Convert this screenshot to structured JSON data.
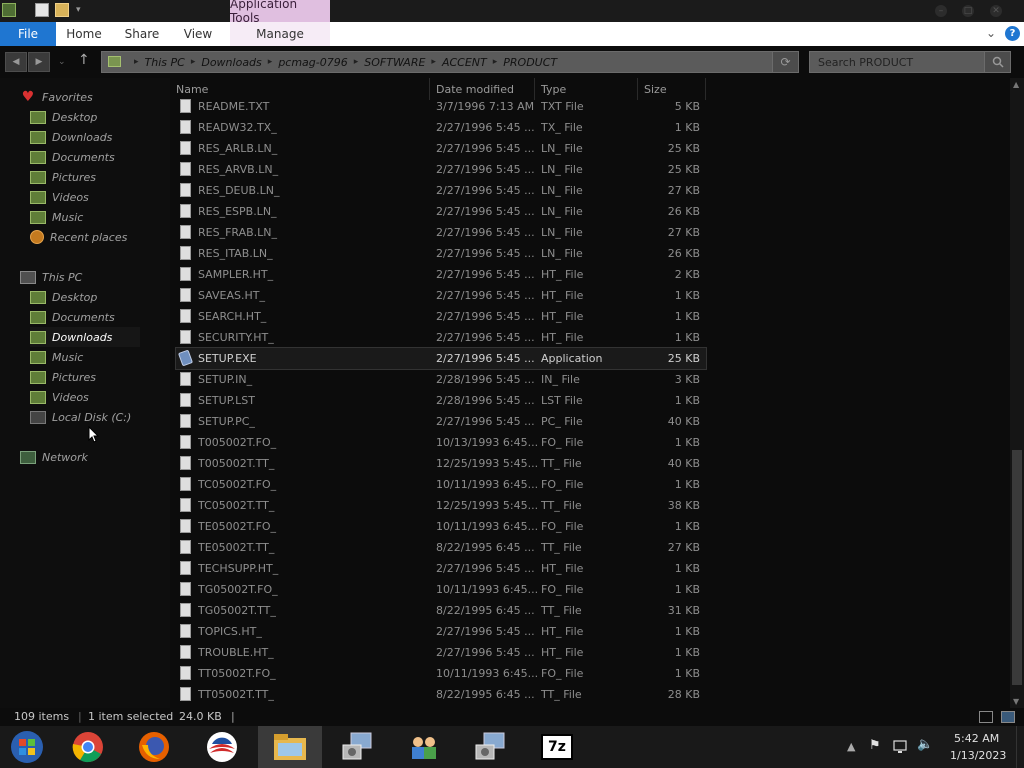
{
  "ribbon": {
    "contextual_group": "Application Tools",
    "file_tab": "File",
    "tabs": [
      "Home",
      "Share",
      "View",
      "Manage"
    ]
  },
  "address": {
    "crumbs": [
      "This PC",
      "Downloads",
      "pcmag-0796",
      "SOFTWARE",
      "ACCENT",
      "PRODUCT"
    ],
    "search_placeholder": "Search PRODUCT"
  },
  "nav": {
    "favorites_label": "Favorites",
    "favorites": [
      {
        "label": "Desktop",
        "icon": "desktop-folder-icon"
      },
      {
        "label": "Downloads",
        "icon": "downloads-folder-icon"
      },
      {
        "label": "Documents",
        "icon": "documents-folder-icon"
      },
      {
        "label": "Pictures",
        "icon": "pictures-folder-icon"
      },
      {
        "label": "Videos",
        "icon": "videos-folder-icon"
      },
      {
        "label": "Music",
        "icon": "music-folder-icon"
      },
      {
        "label": "Recent places",
        "icon": "recent-places-icon"
      }
    ],
    "this_pc_label": "This PC",
    "this_pc": [
      {
        "label": "Desktop",
        "icon": "desktop-folder-icon"
      },
      {
        "label": "Documents",
        "icon": "documents-folder-icon"
      },
      {
        "label": "Downloads",
        "icon": "downloads-folder-icon"
      },
      {
        "label": "Music",
        "icon": "music-folder-icon"
      },
      {
        "label": "Pictures",
        "icon": "pictures-folder-icon"
      },
      {
        "label": "Videos",
        "icon": "videos-folder-icon"
      },
      {
        "label": "Local Disk (C:)",
        "icon": "local-disk-icon"
      }
    ],
    "selected": "Downloads",
    "network_label": "Network"
  },
  "columns": [
    "Name",
    "Date modified",
    "Type",
    "Size"
  ],
  "files": [
    {
      "name": "README.TXT",
      "date": "3/7/1996 7:13 AM",
      "type": "TXT File",
      "size": "5 KB"
    },
    {
      "name": "READW32.TX_",
      "date": "2/27/1996 5:45 ...",
      "type": "TX_ File",
      "size": "1 KB"
    },
    {
      "name": "RES_ARLB.LN_",
      "date": "2/27/1996 5:45 ...",
      "type": "LN_ File",
      "size": "25 KB"
    },
    {
      "name": "RES_ARVB.LN_",
      "date": "2/27/1996 5:45 ...",
      "type": "LN_ File",
      "size": "25 KB"
    },
    {
      "name": "RES_DEUB.LN_",
      "date": "2/27/1996 5:45 ...",
      "type": "LN_ File",
      "size": "27 KB"
    },
    {
      "name": "RES_ESPB.LN_",
      "date": "2/27/1996 5:45 ...",
      "type": "LN_ File",
      "size": "26 KB"
    },
    {
      "name": "RES_FRAB.LN_",
      "date": "2/27/1996 5:45 ...",
      "type": "LN_ File",
      "size": "27 KB"
    },
    {
      "name": "RES_ITAB.LN_",
      "date": "2/27/1996 5:45 ...",
      "type": "LN_ File",
      "size": "26 KB"
    },
    {
      "name": "SAMPLER.HT_",
      "date": "2/27/1996 5:45 ...",
      "type": "HT_ File",
      "size": "2 KB"
    },
    {
      "name": "SAVEAS.HT_",
      "date": "2/27/1996 5:45 ...",
      "type": "HT_ File",
      "size": "1 KB"
    },
    {
      "name": "SEARCH.HT_",
      "date": "2/27/1996 5:45 ...",
      "type": "HT_ File",
      "size": "1 KB"
    },
    {
      "name": "SECURITY.HT_",
      "date": "2/27/1996 5:45 ...",
      "type": "HT_ File",
      "size": "1 KB"
    },
    {
      "name": "SETUP.EXE",
      "date": "2/27/1996 5:45 ...",
      "type": "Application",
      "size": "25 KB",
      "selected": true
    },
    {
      "name": "SETUP.IN_",
      "date": "2/28/1996 5:45 ...",
      "type": "IN_ File",
      "size": "3 KB"
    },
    {
      "name": "SETUP.LST",
      "date": "2/28/1996 5:45 ...",
      "type": "LST File",
      "size": "1 KB"
    },
    {
      "name": "SETUP.PC_",
      "date": "2/27/1996 5:45 ...",
      "type": "PC_ File",
      "size": "40 KB"
    },
    {
      "name": "T005002T.FO_",
      "date": "10/13/1993 6:45...",
      "type": "FO_ File",
      "size": "1 KB"
    },
    {
      "name": "T005002T.TT_",
      "date": "12/25/1993 5:45...",
      "type": "TT_ File",
      "size": "40 KB"
    },
    {
      "name": "TC05002T.FO_",
      "date": "10/11/1993 6:45...",
      "type": "FO_ File",
      "size": "1 KB"
    },
    {
      "name": "TC05002T.TT_",
      "date": "12/25/1993 5:45...",
      "type": "TT_ File",
      "size": "38 KB"
    },
    {
      "name": "TE05002T.FO_",
      "date": "10/11/1993 6:45...",
      "type": "FO_ File",
      "size": "1 KB"
    },
    {
      "name": "TE05002T.TT_",
      "date": "8/22/1995 6:45 ...",
      "type": "TT_ File",
      "size": "27 KB"
    },
    {
      "name": "TECHSUPP.HT_",
      "date": "2/27/1996 5:45 ...",
      "type": "HT_ File",
      "size": "1 KB"
    },
    {
      "name": "TG05002T.FO_",
      "date": "10/11/1993 6:45...",
      "type": "FO_ File",
      "size": "1 KB"
    },
    {
      "name": "TG05002T.TT_",
      "date": "8/22/1995 6:45 ...",
      "type": "TT_ File",
      "size": "31 KB"
    },
    {
      "name": "TOPICS.HT_",
      "date": "2/27/1996 5:45 ...",
      "type": "HT_ File",
      "size": "1 KB"
    },
    {
      "name": "TROUBLE.HT_",
      "date": "2/27/1996 5:45 ...",
      "type": "HT_ File",
      "size": "1 KB"
    },
    {
      "name": "TT05002T.FO_",
      "date": "10/11/1993 6:45...",
      "type": "FO_ File",
      "size": "1 KB"
    },
    {
      "name": "TT05002T.TT_",
      "date": "8/22/1995 6:45 ...",
      "type": "TT_ File",
      "size": "28 KB"
    }
  ],
  "status": {
    "item_count": "109 items",
    "selection": "1 item selected",
    "selection_size": "24.0 KB"
  },
  "taskbar": {
    "apps": [
      "start-icon",
      "chrome-icon",
      "firefox-icon",
      "obama-logo-icon",
      "file-explorer-icon",
      "setup-app-icon",
      "network-users-icon",
      "setup-app-icon",
      "7zip-icon"
    ],
    "time": "5:42 AM",
    "date": "1/13/2023",
    "seven_zip_label": "7z"
  },
  "colors": {
    "accent": "#1f76d1",
    "ribbon_contextual": "#e0bfe0",
    "background": "#0c0c0c"
  }
}
